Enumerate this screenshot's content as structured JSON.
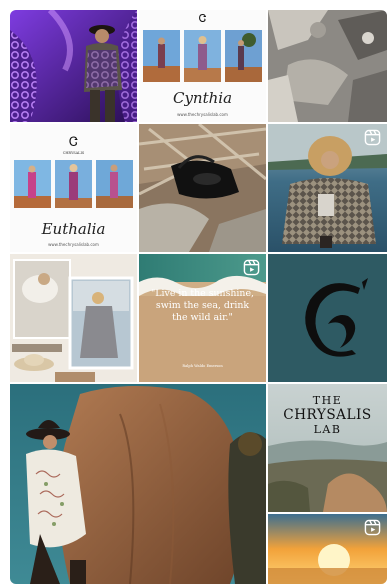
{
  "grid": {
    "tiles": [
      {
        "id": "1",
        "kind": "photo",
        "alt": "purple-crochet-runway"
      },
      {
        "id": "2",
        "kind": "collage",
        "brand": "CHRYSALIS",
        "script_title": "Cynthia",
        "url": "www.thechrysalislab.com"
      },
      {
        "id": "3",
        "kind": "photo",
        "alt": "rock-texture"
      },
      {
        "id": "4",
        "kind": "collage",
        "brand": "CHRYSALIS",
        "script_title": "Euthalia",
        "url": "www.thechrysalislab.com"
      },
      {
        "id": "5",
        "kind": "photo",
        "alt": "leather-bag-on-driftwood"
      },
      {
        "id": "6",
        "kind": "photo",
        "alt": "model-in-patterned-jacket",
        "reel": true
      },
      {
        "id": "7",
        "kind": "photo",
        "alt": "moodboard-collage"
      },
      {
        "id": "8",
        "kind": "quote",
        "reel": true,
        "quote": "\"Live in the sunshine, swim the sea, drink the wild air.\"",
        "author": "Ralph Waldo Emerson"
      },
      {
        "id": "9",
        "kind": "logo",
        "letter": "C"
      },
      {
        "id": "10",
        "kind": "photo",
        "alt": "model-hat-against-rock"
      },
      {
        "id": "11",
        "kind": "title",
        "line1": "THE",
        "line2": "CHRYSALIS",
        "line3": "LAB"
      },
      {
        "id": "12",
        "kind": "photo",
        "alt": "sunset-over-sea",
        "reel": true
      }
    ]
  },
  "colors": {
    "teal": "#2e5a63",
    "sand": "#c9a47c",
    "purple": "#6a2bb6"
  }
}
